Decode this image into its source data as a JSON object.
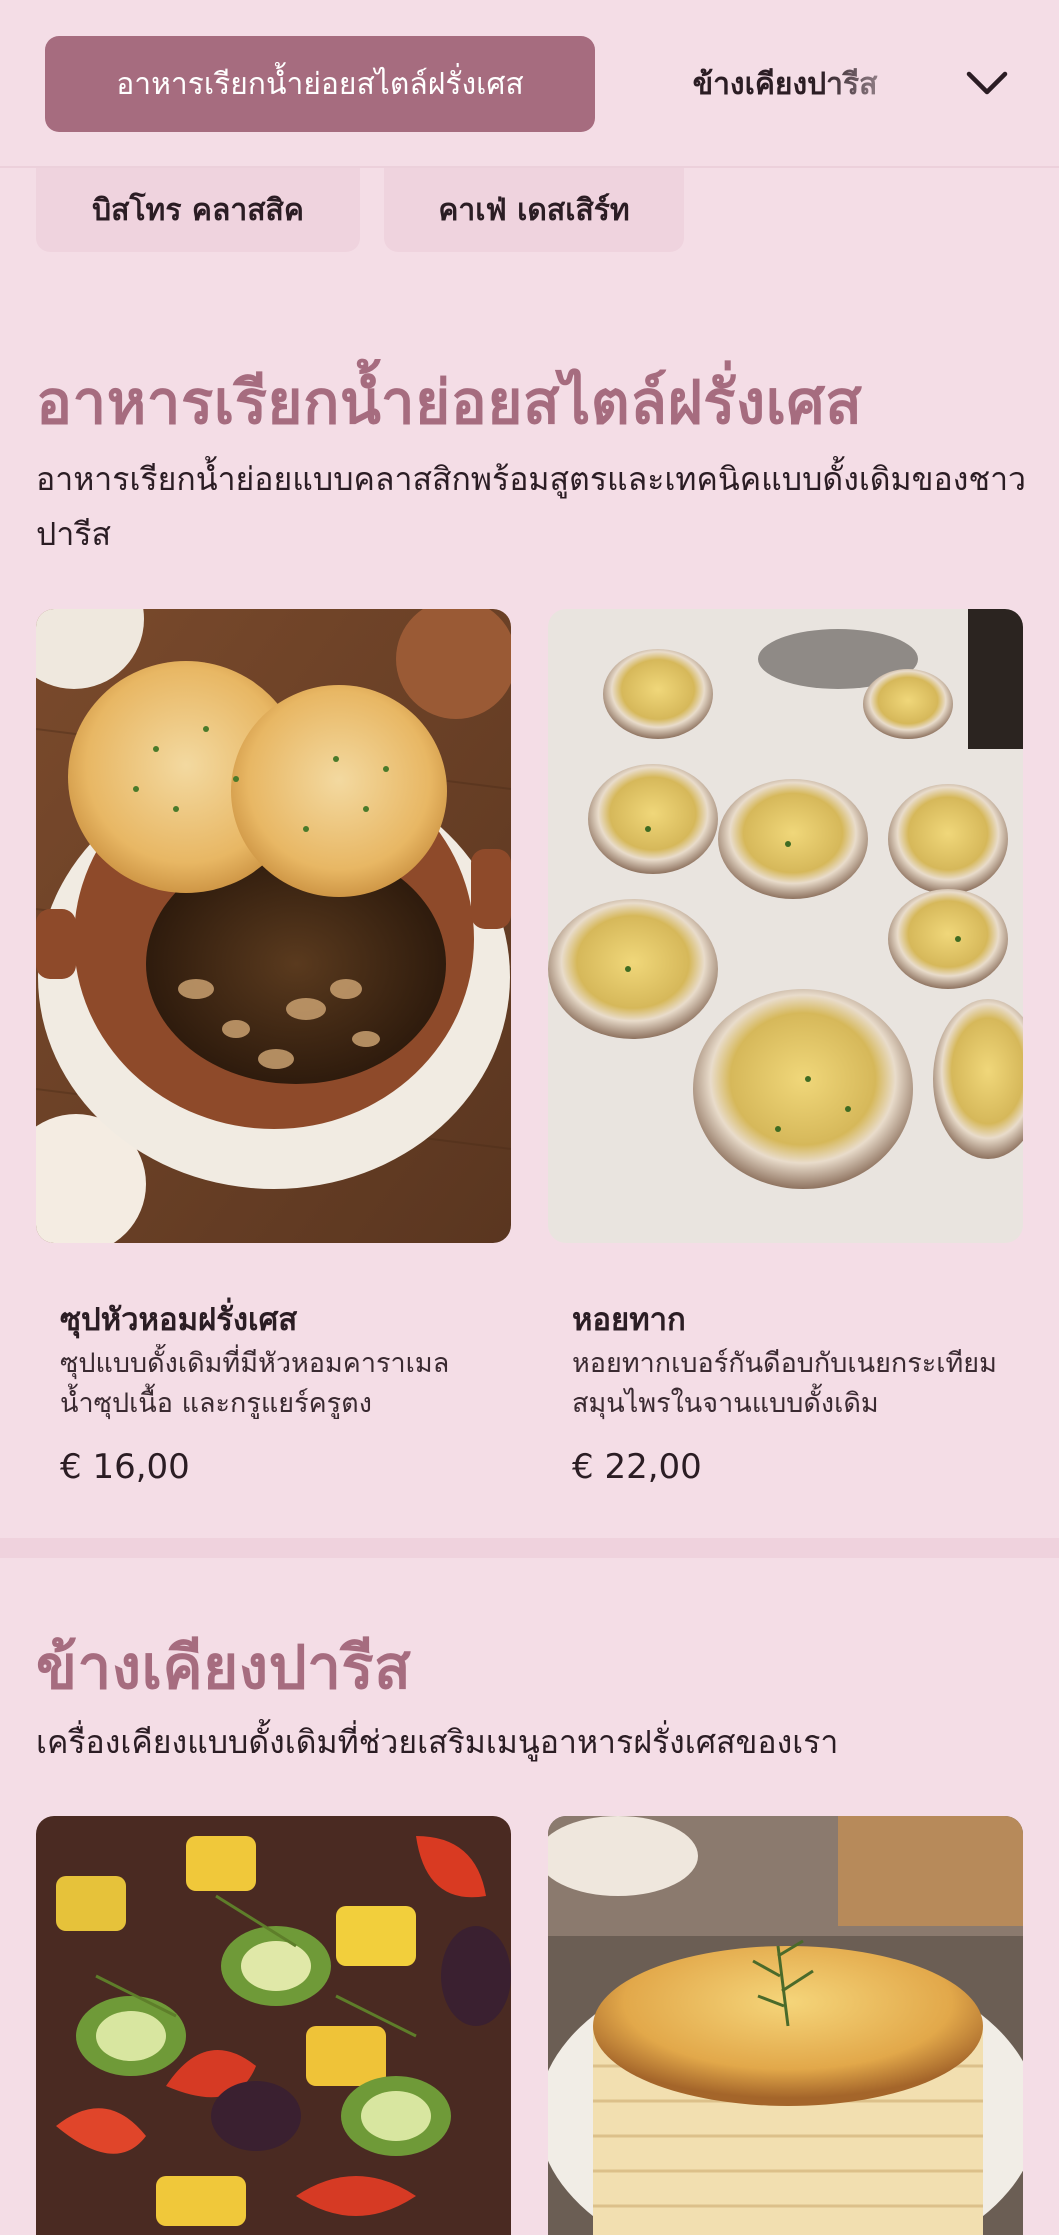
{
  "header": {
    "active_category": "อาหารเรียกน้ำย่อยสไตล์ฝรั่งเศส",
    "next_category": "ข้างเคียงปารีส",
    "dropdown_icon": "chevron-down-icon"
  },
  "chips": [
    "บิสโทร คลาสสิค",
    "คาเฟ่ เดสเสิร์ท"
  ],
  "sections": [
    {
      "title": "อาหารเรียกน้ำย่อยสไตล์ฝรั่งเศส",
      "description": "อาหารเรียกน้ำย่อยแบบคลาสสิกพร้อมสูตรและเทคนิคแบบดั้งเดิมของชาวปารีส",
      "items": [
        {
          "name": "ซุปหัวหอมฝรั่งเศส",
          "description": "ซุปแบบดั้งเดิมที่มีหัวหอมคาราเมล น้ำซุปเนื้อ และกรูแยร์ครูตง",
          "price": "€ 16,00"
        },
        {
          "name": "หอยทาก",
          "description": "หอยทากเบอร์กันดีอบกับเนยกระเทียมสมุนไพรในจานแบบดั้งเดิม",
          "price": "€ 22,00"
        }
      ]
    },
    {
      "title": "ข้างเคียงปารีส",
      "description": "เครื่องเคียงแบบดั้งเดิมที่ช่วยเสริมเมนูอาหารฝรั่งเศสของเรา"
    }
  ],
  "colors": {
    "background": "#f4dde6",
    "accent": "#a66c7f",
    "text": "#2b1d24"
  }
}
